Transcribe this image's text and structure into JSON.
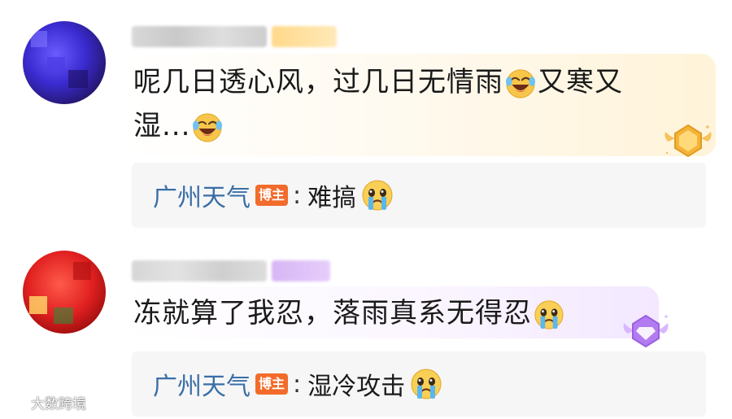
{
  "comments": [
    {
      "text_line1": "呢几日透心风，过几日无情雨",
      "text_line1_tail": "又寒又",
      "text_line2": "湿...",
      "emoji_1": "laughing-crying-icon",
      "emoji_2": "laughing-crying-icon",
      "medal": "gold-medal-icon",
      "reply": {
        "author": "广州天气",
        "badge": "博主",
        "colon": ":",
        "text": "难搞",
        "emoji": "crying-face-icon"
      }
    },
    {
      "text": "冻就算了我忍，落雨真系无得忍",
      "emoji": "crying-face-icon",
      "medal": "purple-diamond-medal-icon",
      "reply": {
        "author": "广州天气",
        "badge": "博主",
        "colon": ":",
        "text": "湿冷攻击",
        "emoji": "crying-face-icon"
      }
    }
  ],
  "watermark": {
    "text": "大数跨境"
  },
  "colors": {
    "reply_author": "#3a6ea5",
    "blogger_badge": "#f26b2a",
    "reply_bg": "#f6f6f7"
  }
}
